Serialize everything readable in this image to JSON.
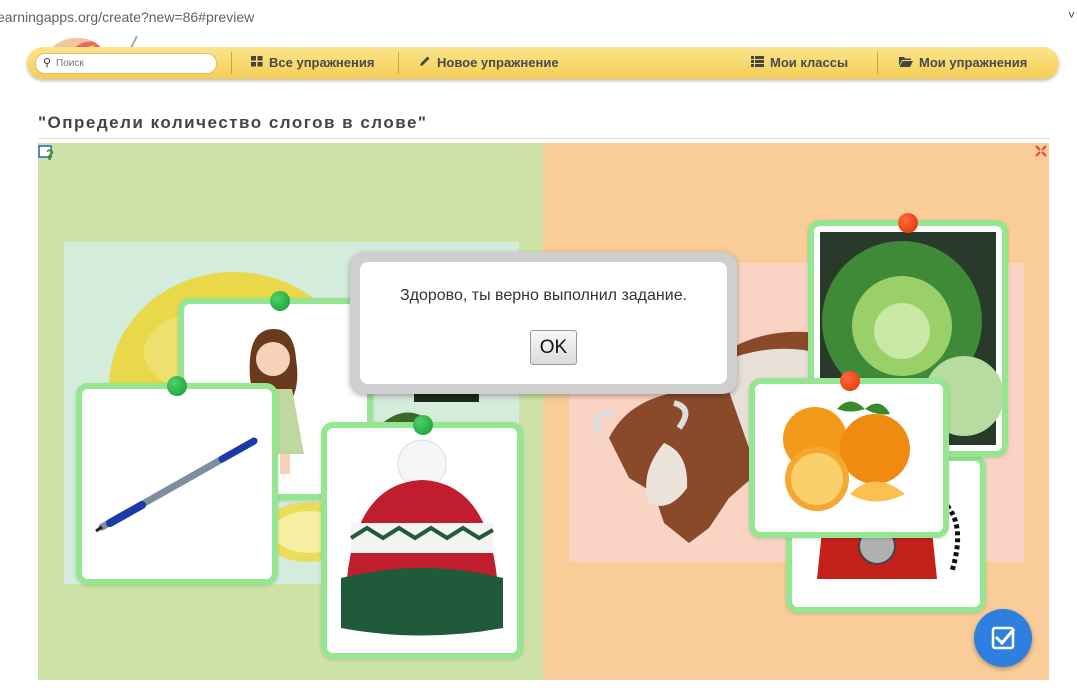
{
  "browser": {
    "url": "earningapps.org/create?new=86#preview"
  },
  "nav": {
    "search_placeholder": "Поиск",
    "all_exercises": "Все упражнения",
    "new_exercise": "Новое упражнение",
    "my_classes": "Мои классы",
    "my_exercises": "Мои упражнения"
  },
  "exercise": {
    "title": "\"Определи количество слогов в слове\""
  },
  "dialog": {
    "message": "Здорово, ты верно выполнил задание.",
    "ok_label": "OK"
  },
  "colors": {
    "card_border": "#94e690",
    "left_background": "#cde3a6",
    "right_background": "#f9cc98",
    "green_pin": "#1fa83a",
    "red_pin": "#f04010",
    "check_button": "#2f7fe0"
  },
  "icons": [
    "search-icon",
    "grid-icon",
    "pencil-icon",
    "list-icon",
    "folder-icon",
    "help-icon",
    "fullscreen-icon",
    "check-icon"
  ],
  "cards": {
    "green_group": [
      "doll",
      "pen",
      "hat"
    ],
    "red_group": [
      "cabbage",
      "orange",
      "telephone"
    ]
  }
}
